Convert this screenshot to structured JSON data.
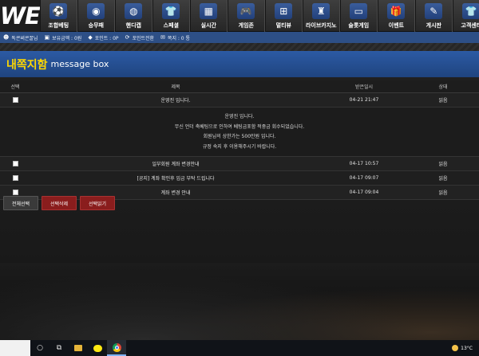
{
  "logo": "WE",
  "nav": [
    {
      "label": "조합베팅",
      "icon": "soccer-ball-icon",
      "glyph": "⚽"
    },
    {
      "label": "승무패",
      "icon": "ball-icon",
      "glyph": "◉"
    },
    {
      "label": "핸디캡",
      "icon": "basketball-icon",
      "glyph": "◍"
    },
    {
      "label": "스페셜",
      "icon": "jersey-icon",
      "glyph": "👕"
    },
    {
      "label": "실시간",
      "icon": "field-icon",
      "glyph": "▦"
    },
    {
      "label": "게임존",
      "icon": "gamepad-icon",
      "glyph": "🎮"
    },
    {
      "label": "멀티뷰",
      "icon": "tournament-icon",
      "glyph": "⊞"
    },
    {
      "label": "라이브카지노",
      "icon": "castle-icon",
      "glyph": "♜"
    },
    {
      "label": "슬롯게임",
      "icon": "slot-machine-icon",
      "glyph": "▭"
    },
    {
      "label": "이벤트",
      "icon": "gift-icon",
      "glyph": "🎁"
    },
    {
      "label": "게시판",
      "icon": "pen-icon",
      "glyph": "✎"
    },
    {
      "label": "고객센터",
      "icon": "shirt-icon",
      "glyph": "👕"
    }
  ],
  "infobar": {
    "user": "똑콘써콘꿀님",
    "balance": "보유금액 : 0원",
    "points": "포인트 : 0P",
    "point_convert": "포인트전환",
    "messages": "쪽지 : 0 통"
  },
  "page_title": {
    "kr": "내쪽지함",
    "en": "message box"
  },
  "table": {
    "headers": {
      "select": "선택",
      "title": "제목",
      "date": "받은일시",
      "status": "상태"
    },
    "rows": [
      {
        "title": "운영진 입니다.",
        "date": "04-21 21:47",
        "status": "읽음"
      },
      {
        "title": "일부회원 계좌 변경안내",
        "date": "04-17 10:57",
        "status": "읽음"
      },
      {
        "title": "[공지] 계좌 확인후 입금 부탁 드립니다",
        "date": "04-17 09:07",
        "status": "읽음"
      },
      {
        "title": "계좌 변경 안내",
        "date": "04-17 09:04",
        "status": "읽음"
      }
    ],
    "expanded_lines": [
      "운영진 입니다.",
      "무신 언더 축베팅으로 인하여 베팅금포함 적중금 회수되었습니다.",
      "회원님의 상한가는 500만원 입니다.",
      "규정 숙지 후 이용해주시기 바랍니다."
    ]
  },
  "actions": {
    "select_all": "전체선택",
    "delete_selected": "선택삭제",
    "read_selected": "선택읽기"
  },
  "taskbar": {
    "weather": "13°C"
  }
}
